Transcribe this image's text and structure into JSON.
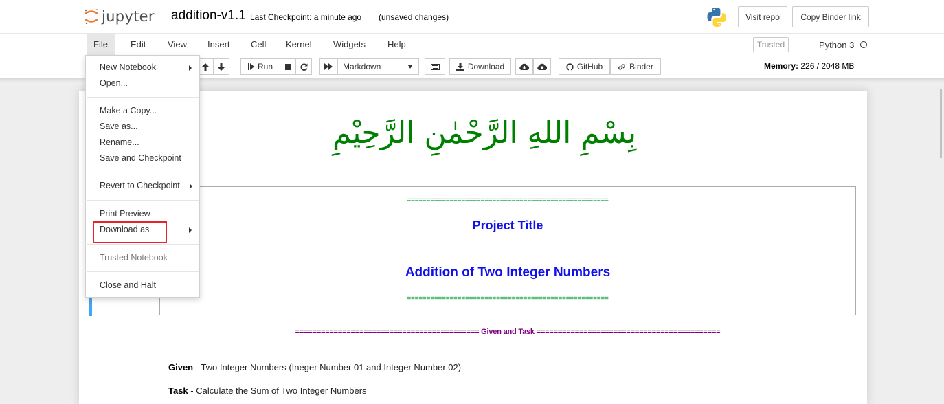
{
  "header": {
    "logo_text": "jupyter",
    "notebook_name": "addition-v1.1",
    "checkpoint": "Last Checkpoint: a minute ago",
    "unsaved": "(unsaved changes)",
    "python_logo_icon": "python-logo-icon",
    "visit_repo": "Visit repo",
    "copy_binder_link": "Copy Binder link"
  },
  "menubar": {
    "items": [
      "File",
      "Edit",
      "View",
      "Insert",
      "Cell",
      "Kernel",
      "Widgets",
      "Help"
    ],
    "active": "File",
    "trusted": "Trusted",
    "kernel": "Python 3"
  },
  "toolbar": {
    "run_label": "Run",
    "cell_type": "Markdown",
    "download_label": "Download",
    "github_label": "GitHub",
    "binder_label": "Binder",
    "memory_label": "Memory:",
    "memory_value": "226 / 2048 MB",
    "icons": [
      "move-up-icon",
      "move-down-icon",
      "run-icon",
      "stop-icon",
      "restart-icon",
      "fast-forward-icon",
      "keyboard-icon",
      "download-icon",
      "cloud-download-icon",
      "cloud-upload-icon",
      "github-icon",
      "binder-icon"
    ]
  },
  "file_menu": {
    "new_notebook": "New Notebook",
    "open": "Open...",
    "make_copy": "Make a Copy...",
    "save_as": "Save as...",
    "rename": "Rename...",
    "save_checkpoint": "Save and Checkpoint",
    "revert": "Revert to Checkpoint",
    "print_preview": "Print Preview",
    "download_as": "Download as",
    "trusted_notebook": "Trusted Notebook",
    "close_halt": "Close and Halt"
  },
  "notebook": {
    "bismillah": "بِسْمِ اللهِ الرَّحْمٰنِ الرَّحِيْمِ",
    "eq_top": "====================================================",
    "project_title": "Project Title",
    "project_subtitle": "Addition of Two Integer Numbers",
    "eq_bottom": "====================================================",
    "given_task_heading": "=========================================== Given and Task ===========================================",
    "given_label": "Given",
    "given_text": " - Two Integer Numbers (Ineger Number 01 and Integer Number 02)",
    "task_label": "Task",
    "task_text": " - Calculate the Sum of Two Integer Numbers"
  },
  "colors": {
    "bismillah": "#008000",
    "title": "#1010ee",
    "heading": "#800080",
    "eq_line": "#009933",
    "selected_cell": "#42a5f5",
    "highlight": "#e8232a"
  }
}
